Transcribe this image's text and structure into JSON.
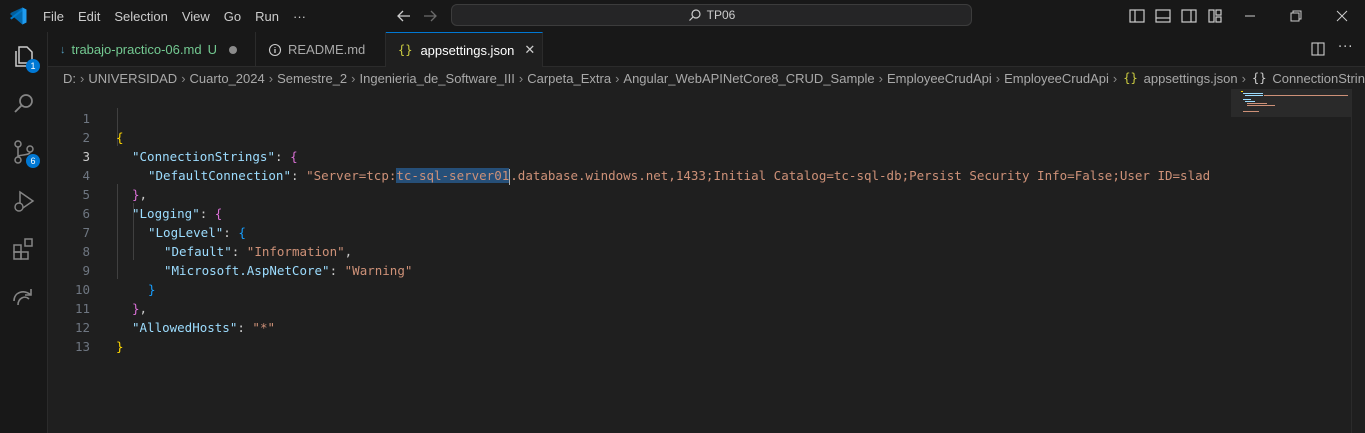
{
  "menu": [
    "File",
    "Edit",
    "Selection",
    "View",
    "Go",
    "Run",
    "···"
  ],
  "command_center": {
    "text": "TP06"
  },
  "activity_badges": {
    "explorer": "1",
    "source_control": "6"
  },
  "tabs": [
    {
      "label": "trabajo-practico-06.md",
      "status": "U",
      "icon": "markdown-icon",
      "modified": true
    },
    {
      "label": "README.md",
      "icon": "info-icon"
    },
    {
      "label": "appsettings.json",
      "icon": "json-braces-icon",
      "active": true
    }
  ],
  "breadcrumb": [
    "D:",
    "UNIVERSIDAD",
    "Cuarto_2024",
    "Semestre_2",
    "Ingenieria_de_Software_III",
    "Carpeta_Extra",
    "Angular_WebAPINetCore8_CRUD_Sample",
    "EmployeeCrudApi",
    "EmployeeCrudApi",
    "appsettings.json",
    "ConnectionStrings"
  ],
  "breadcrumb_icons": {
    "file": "{}",
    "symbol": "{}"
  },
  "editor": {
    "line_numbers": [
      "1",
      "2",
      "3",
      "4",
      "5",
      "6",
      "7",
      "8",
      "9",
      "10",
      "11",
      "12",
      "13"
    ],
    "current_line": "3",
    "l1_open": "{",
    "l2_key": "\"ConnectionStrings\"",
    "l2_colon": ": ",
    "l2_open": "{",
    "l3_key": "\"DefaultConnection\"",
    "l3_colon": ": ",
    "l3_pre": "\"Server=tcp:",
    "l3_sel": "tc-sql-server01",
    "l3_post": ".database.windows.net,1433;Initial Catalog=tc-sql-db;Persist Security Info=False;User ID=slad",
    "l4_close": "}",
    "l4_comma": ",",
    "l5_key": "\"Logging\"",
    "l5_colon": ": ",
    "l5_open": "{",
    "l6_key": "\"LogLevel\"",
    "l6_colon": ": ",
    "l6_open": "{",
    "l7_key": "\"Default\"",
    "l7_colon": ": ",
    "l7_val": "\"Information\"",
    "l7_comma": ",",
    "l8_key": "\"Microsoft.AspNetCore\"",
    "l8_colon": ": ",
    "l8_val": "\"Warning\"",
    "l9_close": "}",
    "l10_close": "}",
    "l10_comma": ",",
    "l11_key": "\"AllowedHosts\"",
    "l11_colon": ": ",
    "l11_val": "\"*\"",
    "l12_close": "}"
  },
  "colors": {
    "accent": "#0078d4",
    "key": "#9cdcfe",
    "string": "#ce9178",
    "bracket1": "#ffd700",
    "bracket2": "#da70d6",
    "bracket3": "#179fff",
    "modified": "#73c991"
  }
}
